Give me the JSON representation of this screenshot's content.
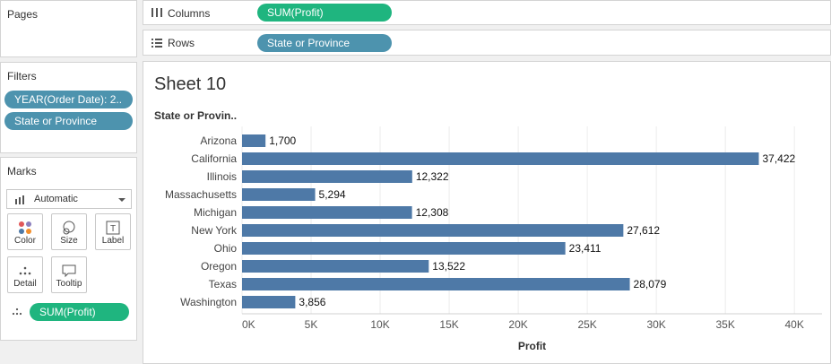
{
  "pages": {
    "title": "Pages"
  },
  "filters": {
    "title": "Filters",
    "items": [
      "YEAR(Order Date): 2..",
      "State or Province"
    ]
  },
  "marks": {
    "title": "Marks",
    "type_selected": "Automatic",
    "buttons": {
      "color": "Color",
      "size": "Size",
      "label": "Label",
      "detail": "Detail",
      "tooltip": "Tooltip"
    },
    "detail_pill": "SUM(Profit)"
  },
  "shelves": {
    "columns_label": "Columns",
    "columns_pill": "SUM(Profit)",
    "rows_label": "Rows",
    "rows_pill": "State or Province"
  },
  "sheet": {
    "title": "Sheet 10"
  },
  "colors": {
    "bar": "#4e79a7",
    "pill_green": "#1fb57f",
    "pill_blue": "#4d93ae"
  },
  "chart_data": {
    "type": "bar",
    "orientation": "horizontal",
    "row_header": "State or Provin..",
    "categories": [
      "Arizona",
      "California",
      "Illinois",
      "Massachusetts",
      "Michigan",
      "New York",
      "Ohio",
      "Oregon",
      "Texas",
      "Washington"
    ],
    "values": [
      1700,
      37422,
      12322,
      5294,
      12308,
      27612,
      23411,
      13522,
      28079,
      3856
    ],
    "value_labels": [
      "1,700",
      "37,422",
      "12,322",
      "5,294",
      "12,308",
      "27,612",
      "23,411",
      "13,522",
      "28,079",
      "3,856"
    ],
    "xlabel": "Profit",
    "xticks": [
      0,
      5000,
      10000,
      15000,
      20000,
      25000,
      30000,
      35000,
      40000
    ],
    "xtick_labels": [
      "0K",
      "5K",
      "10K",
      "15K",
      "20K",
      "25K",
      "30K",
      "35K",
      "40K"
    ],
    "xlim": [
      0,
      42000
    ],
    "grid": true
  }
}
